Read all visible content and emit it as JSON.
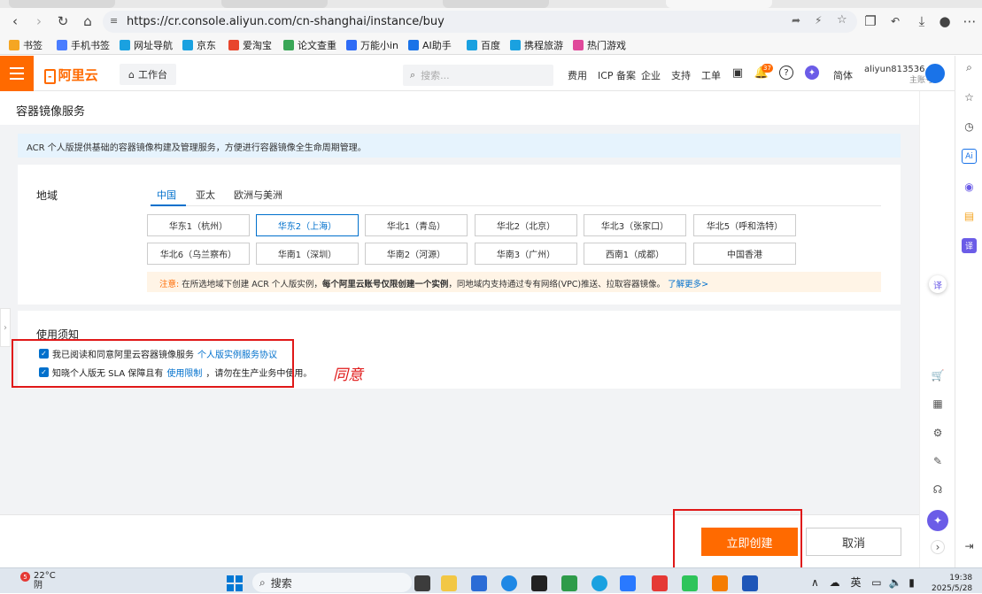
{
  "browser": {
    "url": "https://cr.console.aliyun.com/cn-shanghai/instance/buy",
    "bookmarks": [
      {
        "label": "书签",
        "icon": "star-icon",
        "color": "#f5a623"
      },
      {
        "label": "手机书签",
        "icon": "bookmark-icon",
        "color": "#4a7dff"
      },
      {
        "label": "网址导航",
        "icon": "edge-icon",
        "color": "#1aa1e0"
      },
      {
        "label": "京东",
        "icon": "edge-icon",
        "color": "#1aa1e0"
      },
      {
        "label": "爱淘宝",
        "icon": "taobao-icon",
        "color": "#e8452c"
      },
      {
        "label": "论文查重",
        "icon": "pp-icon",
        "color": "#3aa757"
      },
      {
        "label": "万能小in",
        "icon": "app-icon",
        "color": "#2f6cf6"
      },
      {
        "label": "AI助手",
        "icon": "ai-icon",
        "color": "#1a73e8"
      },
      {
        "label": "百度",
        "icon": "edge-icon",
        "color": "#1aa1e0"
      },
      {
        "label": "携程旅游",
        "icon": "edge-icon",
        "color": "#1aa1e0"
      },
      {
        "label": "热门游戏",
        "icon": "game-icon",
        "color": "#e0499b"
      }
    ]
  },
  "header": {
    "logo": "阿里云",
    "workbench": "工作台",
    "search_placeholder": "搜索...",
    "nav": [
      "费用",
      "ICP 备案",
      "企业",
      "支持",
      "工单"
    ],
    "bell_count": "37",
    "lang": "简体",
    "account_name": "aliyun813536...",
    "account_role": "主账号"
  },
  "page": {
    "title": "容器镜像服务",
    "notice": "ACR 个人版提供基础的容器镜像构建及管理服务，方便进行容器镜像全生命周期管理。"
  },
  "region": {
    "label": "地域",
    "tabs": [
      "中国",
      "亚太",
      "欧洲与美洲"
    ],
    "active_tab": "中国",
    "row1": [
      "华东1（杭州）",
      "华东2（上海）",
      "华北1（青岛）",
      "华北2（北京）",
      "华北3（张家口）",
      "华北5（呼和浩特）"
    ],
    "row2": [
      "华北6（乌兰察布）",
      "华南1（深圳）",
      "华南2（河源）",
      "华南3（广州）",
      "西南1（成都）",
      "中国香港"
    ],
    "selected": "华东2（上海）",
    "note_warn": "注意:",
    "note_pre": "在所选地域下创建 ACR 个人版实例，",
    "note_bold": "每个阿里云账号仅限创建一个实例",
    "note_post": "，同地域内支持通过专有网络(VPC)推送、拉取容器镜像。",
    "note_link": "了解更多>"
  },
  "usage": {
    "title": "使用须知",
    "item1_text": "我已阅读和同意阿里云容器镜像服务",
    "item1_link": "个人版实例服务协议",
    "item2_pre": "知晓个人版无 SLA 保障且有",
    "item2_link": "使用限制",
    "item2_post": "，请勿在生产业务中使用。",
    "item1_checked": true,
    "item2_checked": true
  },
  "annotation": "同意",
  "actions": {
    "create": "立即创建",
    "cancel": "取消"
  },
  "taskbar": {
    "weather_temp": "22°C",
    "weather_cond": "阴",
    "weather_badge": "5",
    "search": "搜索",
    "ime": "英",
    "time": "19:38",
    "date": "2025/5/28"
  }
}
